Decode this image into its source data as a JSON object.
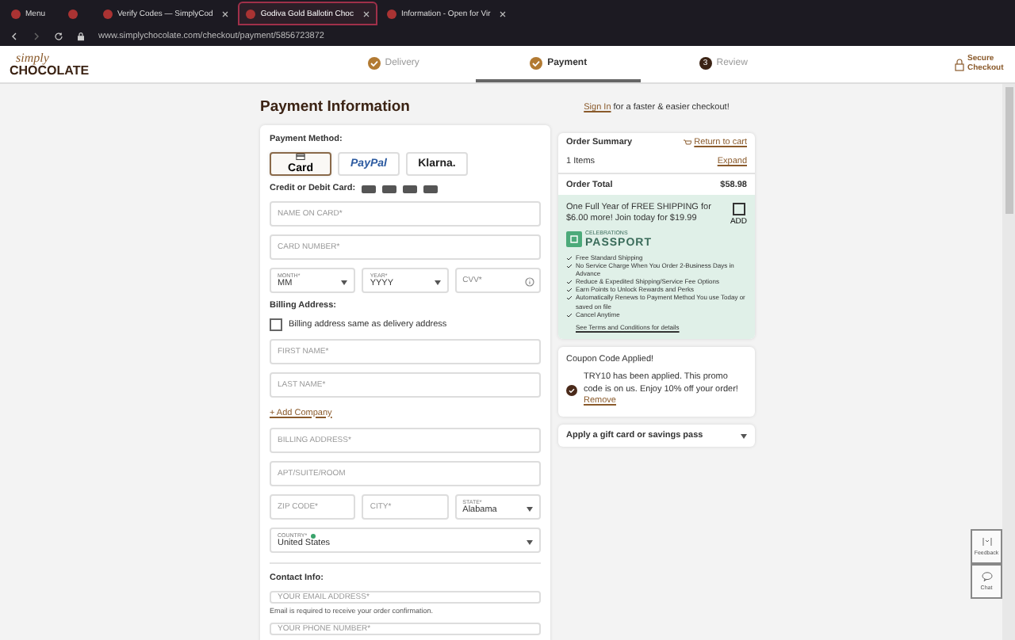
{
  "browser": {
    "tabs": [
      {
        "label": "Menu",
        "selected": false
      },
      {
        "selected": false
      },
      {
        "label": "Verify Codes — SimplyCod",
        "selected": false
      },
      {
        "label": "Godiva Gold Ballotin Choc",
        "selected": true
      },
      {
        "label": "Information - Open for Vir",
        "selected": false
      }
    ],
    "url": "www.simplychocolate.com/checkout/payment/5856723872"
  },
  "header": {
    "logo_top": "simply",
    "logo_bottom": "CHOCOLATE",
    "steps": [
      {
        "label": "Delivery",
        "kind": "done",
        "selected": false
      },
      {
        "label": "Payment",
        "kind": "done",
        "selected": true
      },
      {
        "label": "Review",
        "kind": "number",
        "number": "3",
        "selected": false
      }
    ],
    "secure": "Secure Checkout"
  },
  "page": {
    "title": "Payment Information",
    "sign_in_link": "Sign In",
    "sign_in_text": "for a faster & easier checkout!"
  },
  "payment": {
    "method_label": "Payment Method:",
    "methods": [
      {
        "label": "Card",
        "kind": "card",
        "selected": true
      },
      {
        "label": "PayPal",
        "kind": "paypal",
        "selected": false
      },
      {
        "label": "Klarna.",
        "kind": "klarna",
        "selected": false
      }
    ],
    "card_label": "Credit or Debit Card:",
    "card_rows": [
      [
        {
          "kind": "input",
          "placeholder": "NAME ON CARD*"
        }
      ],
      [
        {
          "kind": "input",
          "placeholder": "CARD NUMBER*"
        }
      ],
      [
        {
          "kind": "select",
          "label": "MONTH*",
          "value": "MM"
        },
        {
          "kind": "select",
          "label": "YEAR*",
          "value": "YYYY"
        },
        {
          "kind": "info",
          "placeholder": "CVV*"
        }
      ]
    ],
    "billing_label": "Billing Address:",
    "same_address": {
      "label": "Billing address same as delivery address",
      "checked": false
    },
    "name_rows": [
      [
        {
          "kind": "input",
          "placeholder": "FIRST NAME*"
        }
      ],
      [
        {
          "kind": "input",
          "placeholder": "LAST NAME*"
        }
      ]
    ],
    "add_company": "+ Add Company",
    "address_rows": [
      [
        {
          "kind": "input",
          "placeholder": "BILLING ADDRESS*"
        }
      ],
      [
        {
          "kind": "input",
          "placeholder": "APT/SUITE/ROOM"
        }
      ],
      [
        {
          "kind": "input",
          "placeholder": "ZIP CODE*"
        },
        {
          "kind": "input",
          "placeholder": "CITY*"
        },
        {
          "kind": "select",
          "label": "STATE*",
          "value": "Alabama"
        }
      ],
      [
        {
          "kind": "select",
          "label": "COUNTRY*",
          "value": "United States",
          "dot": true
        }
      ]
    ],
    "contact_label": "Contact Info:",
    "email_placeholder": "YOUR EMAIL ADDRESS*",
    "email_note": "Email is required to receive your order confirmation.",
    "phone_placeholder": "YOUR PHONE NUMBER*"
  },
  "summary": {
    "title": "Order Summary",
    "return_link": "Return to cart",
    "items": "1 Items",
    "expand": "Expand",
    "total_label": "Order Total",
    "total": "$58.98"
  },
  "passport": {
    "offer": "One Full Year of FREE SHIPPING for $6.00 more! Join today for $19.99",
    "add_label": "ADD",
    "checked": false,
    "brand_top": "CELEBRATIONS",
    "brand_bottom": "PASSPORT",
    "benefits": [
      "Free Standard Shipping",
      "No Service Charge When You Order 2-Business Days in Advance",
      "Reduce & Expedited Shipping/Service Fee Options",
      "Earn Points to Unlock Rewards and Perks",
      "Automatically Renews to Payment Method You use Today or saved on file",
      "Cancel Anytime"
    ],
    "terms": "See Terms and Conditions for details"
  },
  "coupon": {
    "title": "Coupon Code Applied!",
    "message": "TRY10 has been applied. This promo code is on us. Enjoy 10% off your order!",
    "remove": "Remove"
  },
  "gift": {
    "label": "Apply a gift card or savings pass"
  },
  "widgets": [
    {
      "label": "Feedback",
      "kind": "feedback"
    },
    {
      "label": "Chat",
      "kind": "chat"
    }
  ]
}
